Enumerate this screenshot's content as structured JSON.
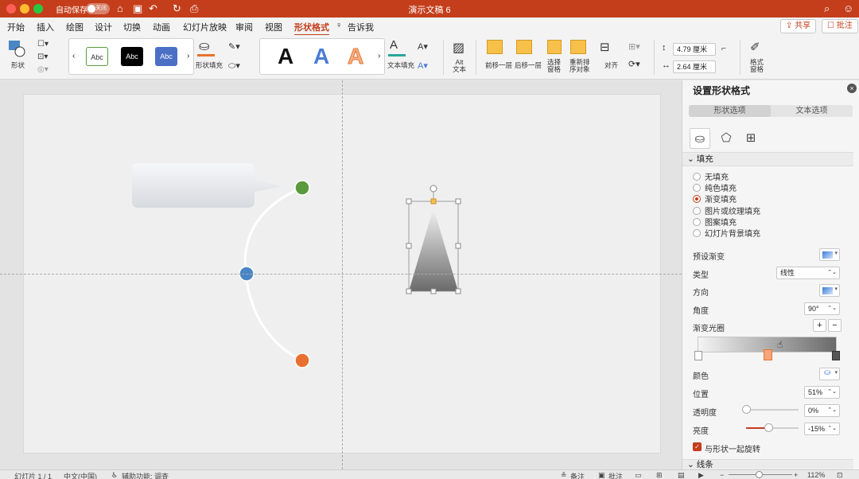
{
  "titlebar": {
    "autosave_label": "自动保存",
    "autosave_state": "关闭",
    "doc_title": "演示文稿 6",
    "icons": [
      "home-icon",
      "save-icon",
      "undo-icon",
      "redo-icon",
      "print-icon"
    ]
  },
  "menu": {
    "tabs": [
      "开始",
      "插入",
      "绘图",
      "设计",
      "切换",
      "动画",
      "幻灯片放映",
      "审阅",
      "视图",
      "形状格式",
      "告诉我"
    ],
    "active": "形状格式",
    "share": "共享",
    "comment": "批注"
  },
  "ribbon": {
    "shape": "形状",
    "styles": [
      "Abc",
      "Abc",
      "Abc"
    ],
    "shape_fill": "形状填充",
    "text_fill": "文本填充",
    "alt_text": "Alt\n文本",
    "bring_forward": "前移一层",
    "send_backward": "后移一层",
    "selection_pane": "选择\n窗格",
    "reorder": "重新排\n序对象",
    "align": "对齐",
    "height": "4.79 厘米",
    "width": "2.64 厘米",
    "format_pane": "格式\n窗格"
  },
  "pane": {
    "title": "设置形状格式",
    "tabs": [
      "形状选项",
      "文本选项"
    ],
    "fill_section": "填充",
    "fill_options": [
      "无填充",
      "纯色填充",
      "渐变填充",
      "图片或纹理填充",
      "图案填充",
      "幻灯片背景填充"
    ],
    "fill_selected": "渐变填充",
    "preset_gradient": "预设渐变",
    "type_label": "类型",
    "type_value": "线性",
    "direction_label": "方向",
    "angle_label": "角度",
    "angle_value": "90°",
    "stops_label": "渐变光圈",
    "color_label": "颜色",
    "position_label": "位置",
    "position_value": "51%",
    "transparency_label": "透明度",
    "transparency_value": "0%",
    "transparency_level": 0,
    "brightness_label": "亮度",
    "brightness_value": "-15%",
    "brightness_level": 0.42,
    "rotate_with_shape": "与形状一起旋转",
    "line_section": "线条"
  },
  "status": {
    "slide": "幻灯片 1 / 1",
    "language": "中文(中国)",
    "accessibility": "辅助功能: 调查",
    "notes": "备注",
    "comments": "批注",
    "zoom": "112%"
  },
  "colors": {
    "accent": "#c43e1c",
    "node_green": "#5a9a3c",
    "node_blue": "#4a86c5",
    "node_orange": "#e87030"
  }
}
